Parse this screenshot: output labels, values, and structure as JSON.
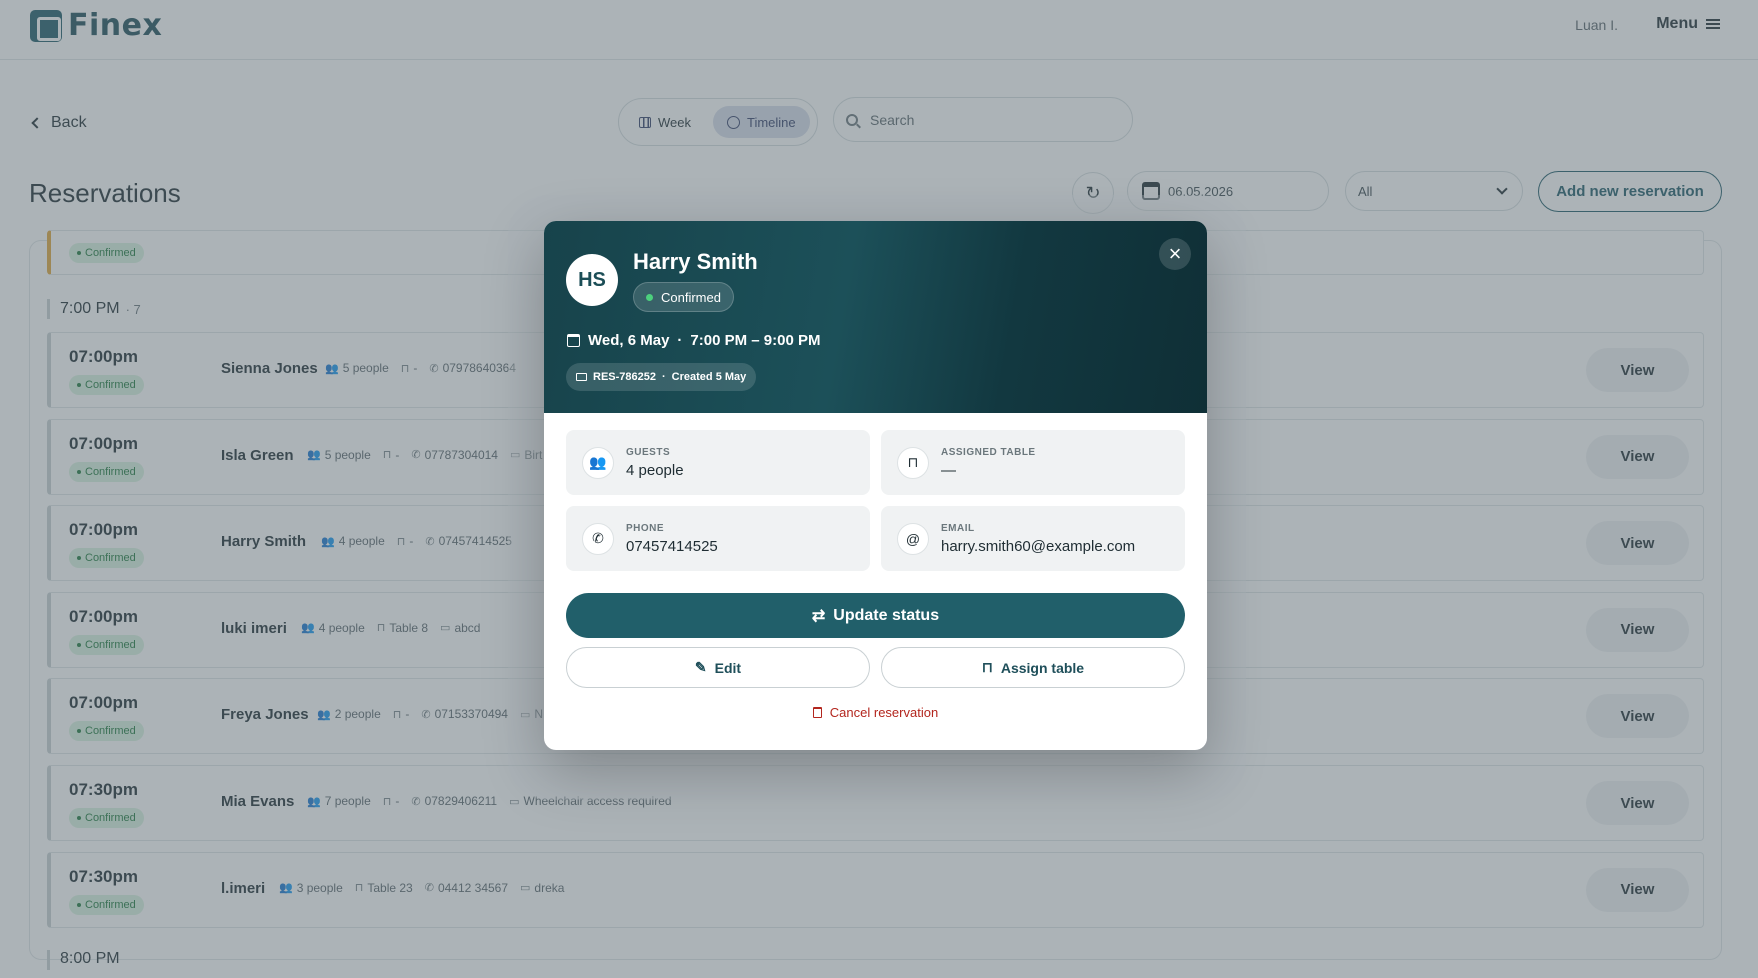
{
  "app": {
    "brand": "Finex",
    "user": "Luan I.",
    "menu_label": "Menu"
  },
  "nav": {
    "back_label": "Back",
    "view_week": "Week",
    "view_timeline": "Timeline",
    "search_placeholder": "Search"
  },
  "page": {
    "title": "Reservations",
    "date": "06.05.2026",
    "filter_value": "All",
    "add_button": "Add new reservation"
  },
  "list": {
    "top_badge": "Confirmed",
    "group": {
      "time": "7:00 PM",
      "count": "· 7"
    },
    "view_label": "View",
    "rows": [
      {
        "time": "07:00pm",
        "status": "Confirmed",
        "name": "Sienna Jones",
        "people": "5 people",
        "table": "-",
        "phone": "07978640364",
        "note": ""
      },
      {
        "time": "07:00pm",
        "status": "Confirmed",
        "name": "Isla Green",
        "people": "5 people",
        "table": "-",
        "phone": "07787304014",
        "note": "Birt"
      },
      {
        "time": "07:00pm",
        "status": "Confirmed",
        "name": "Harry Smith",
        "people": "4 people",
        "table": "-",
        "phone": "07457414525",
        "note": ""
      },
      {
        "time": "07:00pm",
        "status": "Confirmed",
        "name": "luki imeri",
        "people": "4 people",
        "table": "Table 8",
        "phone": "",
        "note": "abcd"
      },
      {
        "time": "07:00pm",
        "status": "Confirmed",
        "name": "Freya Jones",
        "people": "2 people",
        "table": "-",
        "phone": "07153370494",
        "note": "N"
      },
      {
        "time": "07:30pm",
        "status": "Confirmed",
        "name": "Mia Evans",
        "people": "7 people",
        "table": "-",
        "phone": "07829406211",
        "note": "Wheelchair access required"
      },
      {
        "time": "07:30pm",
        "status": "Confirmed",
        "name": "l.imeri",
        "people": "3 people",
        "table": "Table 23",
        "phone": "04412 34567",
        "note": "dreka"
      }
    ],
    "next_group": "8:00 PM"
  },
  "modal": {
    "initials": "HS",
    "name": "Harry Smith",
    "status": "Confirmed",
    "date": "Wed, 6 May",
    "time_range": "7:00 PM – 9:00 PM",
    "ref": "RES-786252",
    "created": "Created 5 May",
    "guests_label": "GUESTS",
    "guests_value": "4 people",
    "table_label": "ASSIGNED TABLE",
    "table_value": "—",
    "phone_label": "PHONE",
    "phone_value": "07457414525",
    "email_label": "EMAIL",
    "email_value": "harry.smith60@example.com",
    "update_status": "Update status",
    "edit": "Edit",
    "assign_table": "Assign table",
    "cancel": "Cancel reservation"
  },
  "colors": {
    "brand": "#1f5b68",
    "confirmed_bg": "#d9f2e0",
    "confirmed_text": "#1f7a3e",
    "danger": "#b3261e",
    "row_accent": "#e0a63a"
  }
}
